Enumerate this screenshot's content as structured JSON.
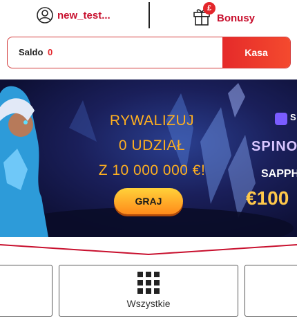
{
  "header": {
    "username": "new_test...",
    "bonus_label": "Bonusy",
    "bonus_badge": "£"
  },
  "balance": {
    "label": "Saldo",
    "value": "0",
    "cashier_button": "Kasa"
  },
  "banner": {
    "line1": "RYWALIZUJ",
    "line2": "0 UDZIAŁ",
    "line3": "Z 10 000 000 €!",
    "cta": "GRAJ",
    "promo_brand": "S",
    "promo_title": "SPINO",
    "promo_sub": "SAPPH",
    "promo_amount": "€100"
  },
  "categories": {
    "main_label": "Wszystkie"
  },
  "colors": {
    "accent": "#c8102e",
    "kasa": "#f0332a",
    "banner_text": "#ffb020"
  }
}
